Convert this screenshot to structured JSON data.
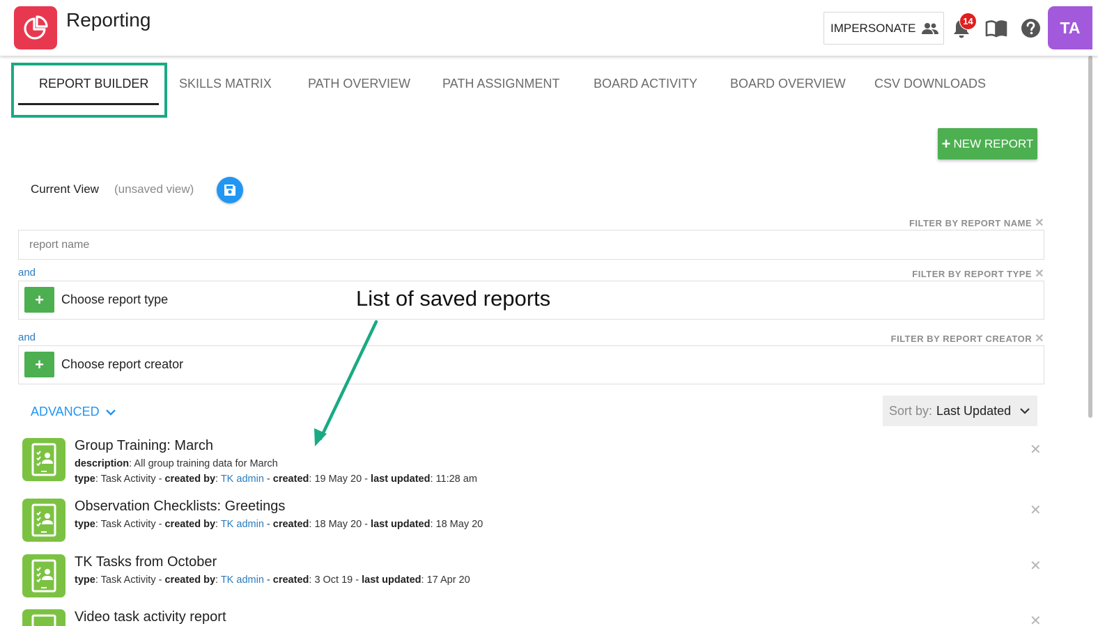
{
  "header": {
    "app_title": "Reporting",
    "impersonate_label": "IMPERSONATE",
    "notification_count": "14",
    "avatar_initials": "TA",
    "colors": {
      "logo": "#e8384f",
      "avatar": "#a259db",
      "badge": "#e11d1d"
    },
    "icons": [
      "pie-chart-icon",
      "people-icon",
      "bell-icon",
      "book-icon",
      "help-icon"
    ]
  },
  "tabs": [
    {
      "label": "REPORT BUILDER",
      "active": true
    },
    {
      "label": "SKILLS MATRIX",
      "active": false
    },
    {
      "label": "PATH OVERVIEW",
      "active": false
    },
    {
      "label": "PATH ASSIGNMENT",
      "active": false
    },
    {
      "label": "BOARD ACTIVITY",
      "active": false
    },
    {
      "label": "BOARD OVERVIEW",
      "active": false
    },
    {
      "label": "CSV DOWNLOADS",
      "active": false
    }
  ],
  "toolbar": {
    "new_report_label": "NEW REPORT",
    "accent_green": "#4caf50"
  },
  "current_view": {
    "label": "Current View",
    "status": "(unsaved view)"
  },
  "filters": {
    "name": {
      "caption": "FILTER BY REPORT NAME",
      "placeholder": "report name",
      "value": ""
    },
    "type": {
      "connector": "and",
      "caption": "FILTER BY REPORT TYPE",
      "text": "Choose report type"
    },
    "creator": {
      "connector": "and",
      "caption": "FILTER BY REPORT CREATOR",
      "text": "Choose report creator"
    }
  },
  "advanced_label": "ADVANCED",
  "sort": {
    "label": "Sort by:",
    "value": "Last Updated"
  },
  "annotation": {
    "text": "List of saved reports",
    "color": "#1aaa83"
  },
  "field_labels": {
    "description": "description",
    "type": "type",
    "created_by": "created by",
    "created": "created",
    "last_updated": "last updated"
  },
  "reports": [
    {
      "title": "Group Training: March",
      "description": "All group training data for March",
      "type": "Task Activity",
      "created_by": "TK admin",
      "created": "19 May 20",
      "last_updated": "11:28 am"
    },
    {
      "title": "Observation Checklists: Greetings",
      "type": "Task Activity",
      "created_by": "TK admin",
      "created": "18 May 20",
      "last_updated": "18 May 20"
    },
    {
      "title": "TK Tasks from October",
      "type": "Task Activity",
      "created_by": "TK admin",
      "created": "3 Oct 19",
      "last_updated": "17 Apr 20"
    },
    {
      "title": "Video task activity report"
    }
  ]
}
